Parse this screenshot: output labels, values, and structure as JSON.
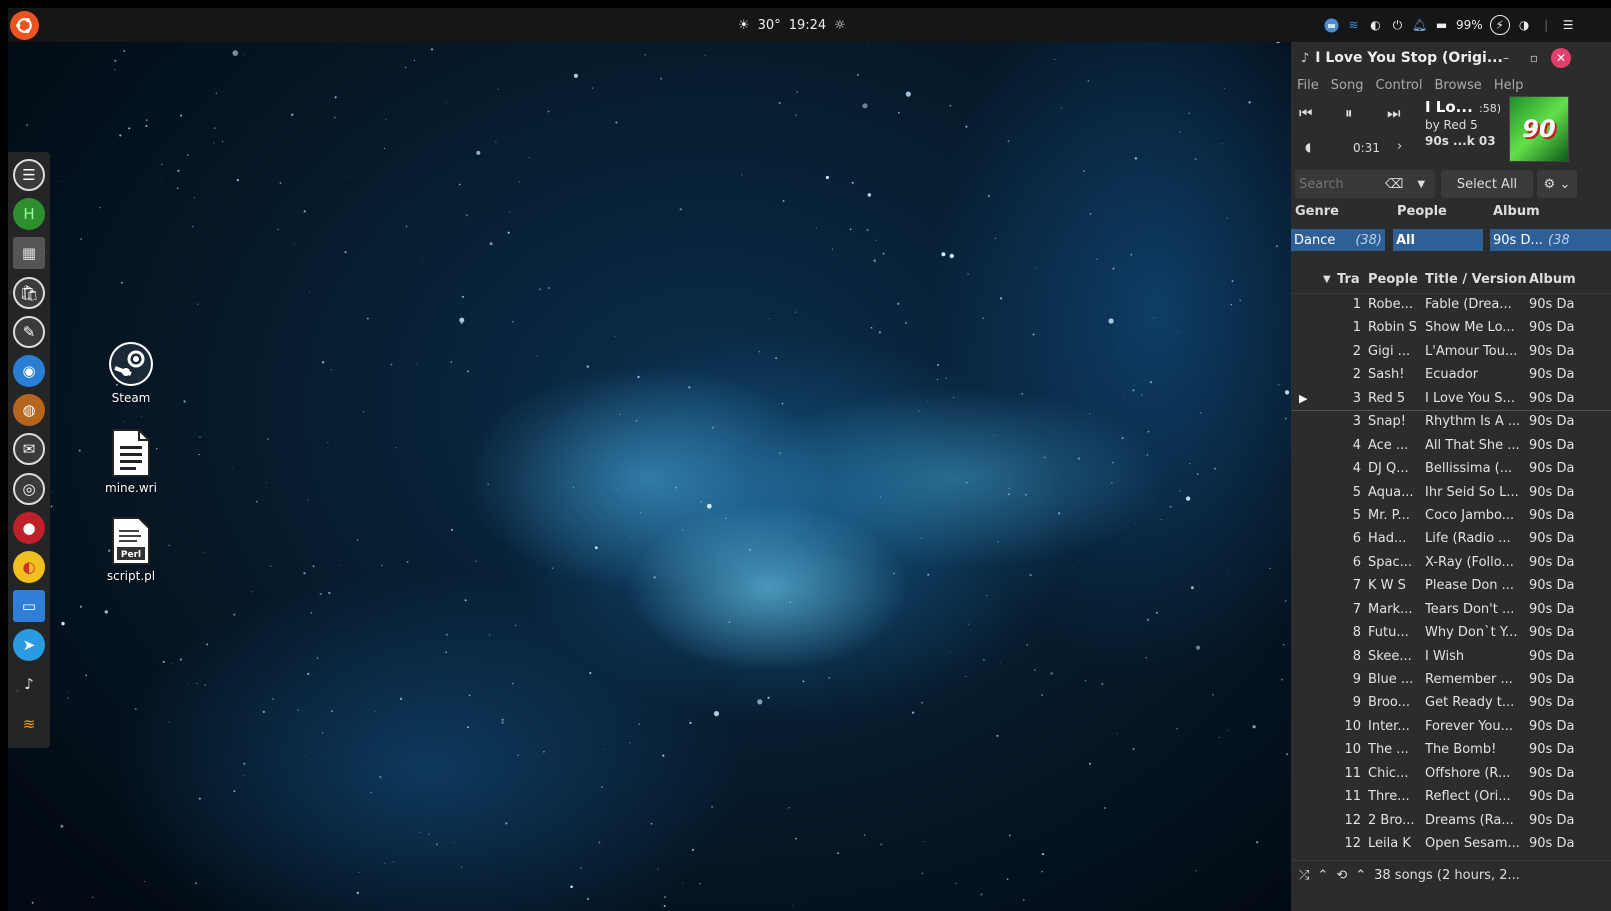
{
  "top_panel": {
    "weather_temp": "30°",
    "time": "19:24",
    "battery": "99%"
  },
  "desktop_icons": [
    {
      "label": "Steam",
      "icon": "steam-icon"
    },
    {
      "label": "mine.wri",
      "icon": "document-icon"
    },
    {
      "label": "script.pl",
      "icon": "perl-script-icon"
    }
  ],
  "dock": [
    {
      "name": "files-icon"
    },
    {
      "name": "hex-editor-icon"
    },
    {
      "name": "terminal-icon"
    },
    {
      "name": "store-icon"
    },
    {
      "name": "text-editor-icon"
    },
    {
      "name": "browser-icon"
    },
    {
      "name": "app-icon"
    },
    {
      "name": "mail-icon"
    },
    {
      "name": "camera-icon"
    },
    {
      "name": "record-icon"
    },
    {
      "name": "color-icon"
    },
    {
      "name": "window-icon"
    },
    {
      "name": "telegram-icon"
    },
    {
      "name": "music-player-icon"
    },
    {
      "name": "layers-icon"
    }
  ],
  "player": {
    "window_title": "I Love You Stop (Origi...",
    "menu": [
      "File",
      "Song",
      "Control",
      "Browse",
      "Help"
    ],
    "now_playing": {
      "title": "I Lo...",
      "time_suffix": ":58)",
      "artist": "by Red 5",
      "album": "90s ...k 03",
      "position": "0:31",
      "cover_text": "90"
    },
    "search_placeholder": "Search",
    "select_all": "Select All",
    "browser": {
      "genre_header": "Genre",
      "people_header": "People",
      "album_header": "Album",
      "genre_value": "Dance",
      "genre_count": "(38)",
      "people_value": "All",
      "album_value": "90s D...",
      "album_count": "(38"
    },
    "columns": {
      "track": "Tra",
      "people": "People",
      "title": "Title / Version",
      "album": "Album"
    },
    "songs": [
      {
        "track": "1",
        "people": "Robe...",
        "title": "Fable (Drea...",
        "album": "90s Da"
      },
      {
        "track": "1",
        "people": "Robin S",
        "title": "Show Me Lo...",
        "album": "90s Da"
      },
      {
        "track": "2",
        "people": "Gigi ...",
        "title": "L'Amour Tou...",
        "album": "90s Da"
      },
      {
        "track": "2",
        "people": "Sash!",
        "title": "Ecuador",
        "album": "90s Da"
      },
      {
        "track": "3",
        "people": "Red 5",
        "title": "I Love You S...",
        "album": "90s Da",
        "playing": true
      },
      {
        "track": "3",
        "people": "Snap!",
        "title": "Rhythm Is A ...",
        "album": "90s Da"
      },
      {
        "track": "4",
        "people": "Ace ...",
        "title": "All That She ...",
        "album": "90s Da"
      },
      {
        "track": "4",
        "people": "DJ Q...",
        "title": "Bellissima (...",
        "album": "90s Da"
      },
      {
        "track": "5",
        "people": "Aqua...",
        "title": "Ihr Seid So L...",
        "album": "90s Da"
      },
      {
        "track": "5",
        "people": "Mr. P...",
        "title": "Coco Jambo...",
        "album": "90s Da"
      },
      {
        "track": "6",
        "people": "Had...",
        "title": "Life (Radio ...",
        "album": "90s Da"
      },
      {
        "track": "6",
        "people": "Spac...",
        "title": "X-Ray (Follo...",
        "album": "90s Da"
      },
      {
        "track": "7",
        "people": "K W S",
        "title": "Please Don ...",
        "album": "90s Da"
      },
      {
        "track": "7",
        "people": "Mark...",
        "title": "Tears Don't ...",
        "album": "90s Da"
      },
      {
        "track": "8",
        "people": "Futu...",
        "title": "Why Don`t Y...",
        "album": "90s Da"
      },
      {
        "track": "8",
        "people": "Skee...",
        "title": "I Wish",
        "album": "90s Da"
      },
      {
        "track": "9",
        "people": "Blue ...",
        "title": "Remember ...",
        "album": "90s Da"
      },
      {
        "track": "9",
        "people": "Broo...",
        "title": "Get Ready t...",
        "album": "90s Da"
      },
      {
        "track": "10",
        "people": "Inter...",
        "title": "Forever You...",
        "album": "90s Da"
      },
      {
        "track": "10",
        "people": "The ...",
        "title": "The Bomb!",
        "album": "90s Da"
      },
      {
        "track": "11",
        "people": "Chic...",
        "title": "Offshore (R...",
        "album": "90s Da"
      },
      {
        "track": "11",
        "people": "Thre...",
        "title": "Reflect (Ori...",
        "album": "90s Da"
      },
      {
        "track": "12",
        "people": "2 Bro...",
        "title": "Dreams (Ra...",
        "album": "90s Da"
      },
      {
        "track": "12",
        "people": "Leila K",
        "title": "Open Sesam...",
        "album": "90s Da"
      }
    ],
    "status": "38 songs (2 hours, 2..."
  }
}
